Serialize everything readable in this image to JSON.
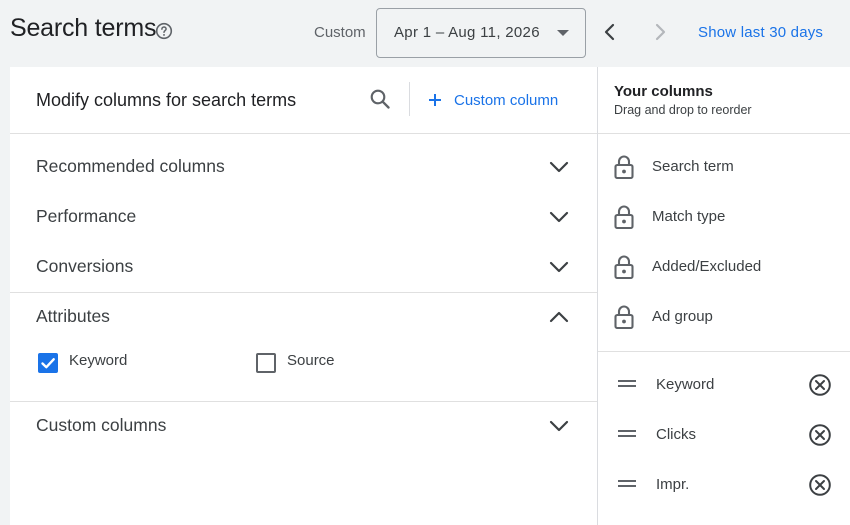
{
  "header": {
    "title": "Search terms",
    "range_label": "Custom",
    "date_range": "Apr 1 – Aug 11, 2026",
    "show_last_label": "Show last 30 days"
  },
  "left": {
    "title": "Modify columns for search terms",
    "custom_column_label": "Custom column",
    "sections": [
      {
        "label": "Recommended columns",
        "expanded": false
      },
      {
        "label": "Performance",
        "expanded": false
      },
      {
        "label": "Conversions",
        "expanded": false
      },
      {
        "label": "Attributes",
        "expanded": true
      },
      {
        "label": "Custom columns",
        "expanded": false
      }
    ],
    "attributes": [
      {
        "label": "Keyword",
        "checked": true
      },
      {
        "label": "Source",
        "checked": false
      }
    ]
  },
  "right": {
    "title": "Your columns",
    "subtitle": "Drag and drop to reorder",
    "locked_columns": [
      "Search term",
      "Match type",
      "Added/Excluded",
      "Ad group"
    ],
    "selected_columns": [
      "Keyword",
      "Clicks",
      "Impr."
    ]
  },
  "icons": {
    "help": "help-circle-icon",
    "date_dropdown": "caret-down-icon",
    "prev": "chevron-left-icon",
    "next": "chevron-right-icon",
    "search": "search-icon",
    "add": "plus-icon",
    "expand": "chevron-down-icon",
    "collapse": "chevron-up-icon",
    "lock": "lock-icon",
    "drag": "drag-handle-icon",
    "remove": "remove-circle-icon"
  },
  "colors": {
    "accent": "#1a73e8",
    "text": "#202124",
    "muted": "#5f6368",
    "background": "#f1f3f4",
    "panel": "#ffffff"
  }
}
